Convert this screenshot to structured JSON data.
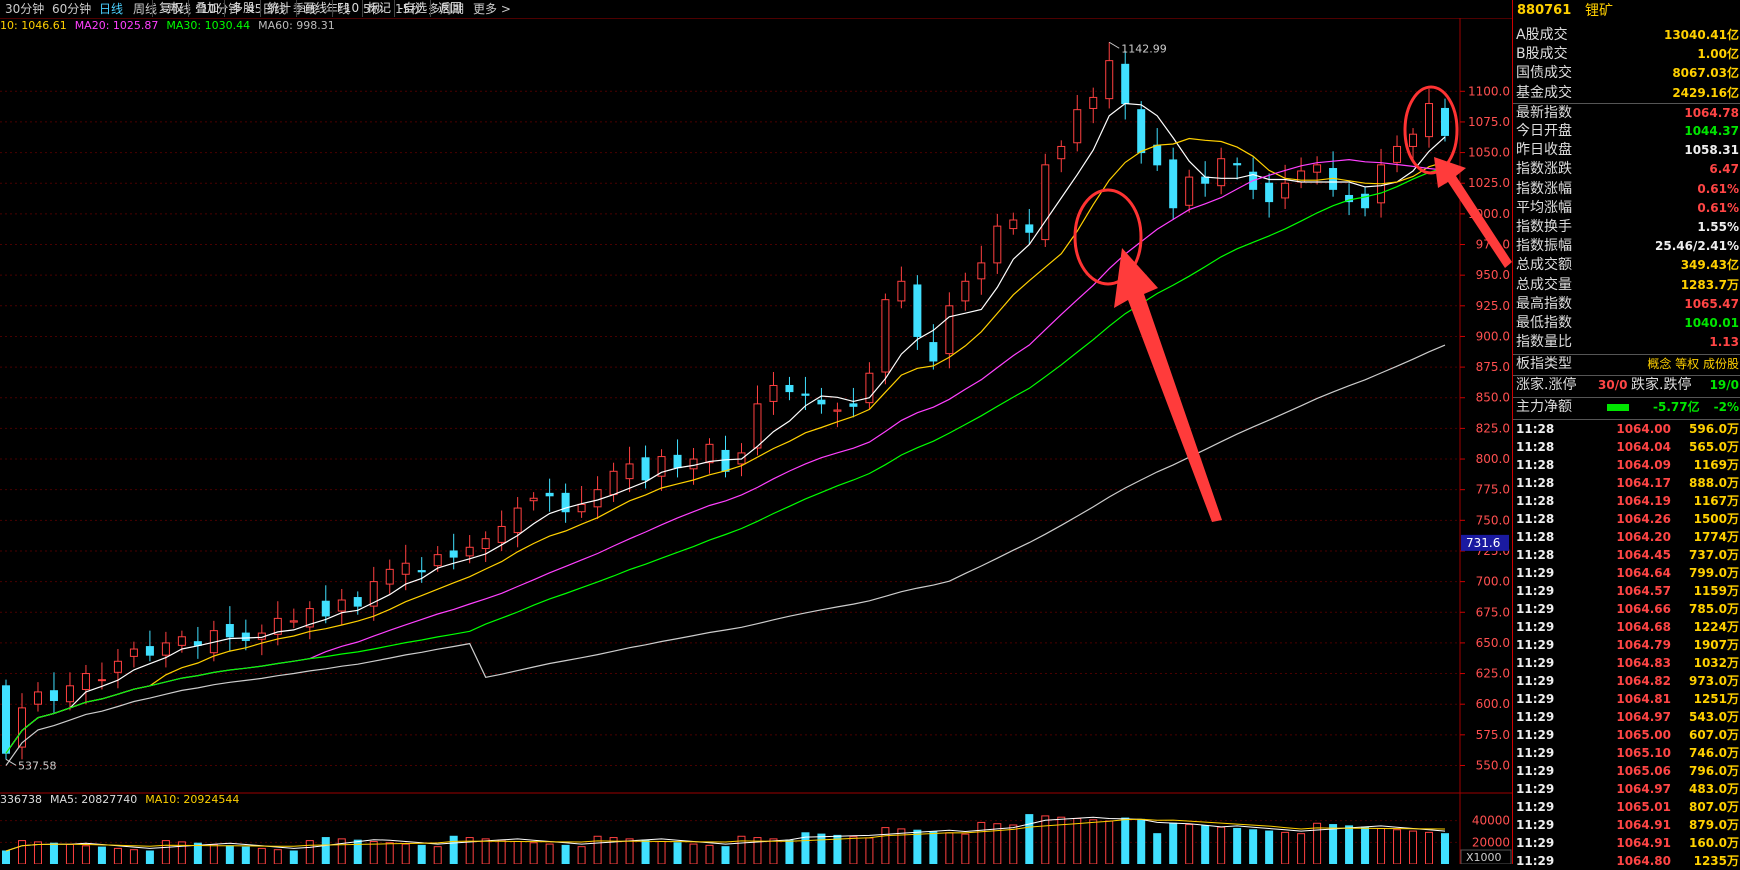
{
  "toolbar": {
    "periods": [
      "30分钟",
      "60分钟",
      "日线",
      "周线",
      "月线",
      "10分钟",
      "45日线",
      "季线",
      "年线",
      "5秒",
      "15秒",
      "多周期",
      "更多 >"
    ],
    "active_period": "日线",
    "tools": [
      "复权",
      "叠加",
      "多股",
      "统计",
      "画线",
      "F10",
      "标记",
      "-自选",
      "返回"
    ]
  },
  "ma_legend": [
    {
      "label": "10: 1046.61",
      "color": "#ffd000"
    },
    {
      "label": "MA20: 1025.87",
      "color": "#ff40ff"
    },
    {
      "label": "MA30: 1030.44",
      "color": "#00ff00"
    },
    {
      "label": "MA60: 998.31",
      "color": "#bbbbbb"
    }
  ],
  "vol_legend": [
    {
      "label": "336738",
      "color": "#dddddd"
    },
    {
      "label": "MA5: 20827740",
      "color": "#dddddd"
    },
    {
      "label": "MA10: 20924544",
      "color": "#ffd000"
    }
  ],
  "price_axis": {
    "ticks": [
      1100,
      1075,
      1050,
      1025,
      1000,
      975,
      950,
      925,
      900,
      875,
      850,
      825,
      800,
      775,
      750,
      725,
      700,
      675,
      650,
      625,
      600,
      575,
      550
    ]
  },
  "volume_axis": {
    "ticks": [
      "40000",
      "20000"
    ],
    "unit": "X1000"
  },
  "markers": {
    "high": "1142.99",
    "low": "537.58",
    "crosshair_price": "731.6"
  },
  "colors": {
    "up": "#ff4040",
    "down": "#40e0ff",
    "ma10": "#ffd000",
    "ma20": "#ff40ff",
    "ma30": "#00ff00",
    "ma60": "#cccccc",
    "annotation": "#ff3333"
  },
  "chart_data": {
    "type": "candlestick",
    "ylim": [
      530,
      1150
    ],
    "close": [
      560,
      597,
      610,
      603,
      615,
      625,
      620,
      635,
      645,
      640,
      650,
      655,
      648,
      660,
      655,
      652,
      658,
      670,
      668,
      678,
      672,
      685,
      680,
      700,
      710,
      715,
      708,
      722,
      720,
      728,
      735,
      745,
      760,
      768,
      770,
      757,
      763,
      775,
      790,
      796,
      783,
      802,
      793,
      800,
      812,
      790,
      805,
      845,
      860,
      855,
      852,
      845,
      840,
      843,
      870,
      930,
      945,
      900,
      880,
      925,
      945,
      960,
      990,
      995,
      985,
      1040,
      1055,
      1085,
      1095,
      1125,
      1090,
      1050,
      1040,
      1005,
      1030,
      1025,
      1045,
      1040,
      1020,
      1010,
      1025,
      1035,
      1040,
      1020,
      1010,
      1005,
      1040,
      1055,
      1065,
      1090,
      1064
    ]
  },
  "side": {
    "code": "880761",
    "name": "锂矿",
    "stats": [
      {
        "label": "A股成交",
        "value": "13040.41亿",
        "color": "yellow"
      },
      {
        "label": "B股成交",
        "value": "1.00亿",
        "color": "yellow"
      },
      {
        "label": "国债成交",
        "value": "8067.03亿",
        "color": "yellow"
      },
      {
        "label": "基金成交",
        "value": "2429.16亿",
        "color": "yellow"
      },
      {
        "label": "最新指数",
        "value": "1064.78",
        "color": "red"
      },
      {
        "label": "今日开盘",
        "value": "1044.37",
        "color": "green"
      },
      {
        "label": "昨日收盘",
        "value": "1058.31",
        "color": "white"
      },
      {
        "label": "指数涨跌",
        "value": "6.47",
        "color": "red"
      },
      {
        "label": "指数涨幅",
        "value": "0.61%",
        "color": "red"
      },
      {
        "label": "平均涨幅",
        "value": "0.61%",
        "color": "red"
      },
      {
        "label": "指数换手",
        "value": "1.55%",
        "color": "white"
      },
      {
        "label": "指数振幅",
        "value": "25.46/2.41%",
        "color": "white"
      },
      {
        "label": "总成交额",
        "value": "349.43亿",
        "color": "yellow"
      },
      {
        "label": "总成交量",
        "value": "1283.7万",
        "color": "yellow"
      },
      {
        "label": "最高指数",
        "value": "1065.47",
        "color": "red"
      },
      {
        "label": "最低指数",
        "value": "1040.01",
        "color": "green"
      },
      {
        "label": "指数量比",
        "value": "1.13",
        "color": "red"
      }
    ],
    "type_row": {
      "label": "板指类型",
      "opts": "概念 等权 成份股"
    },
    "updown_row": {
      "l1": "涨家.涨停",
      "v1": "30/0",
      "l2": "跌家.跌停",
      "v2": "19/0"
    },
    "flow_row": {
      "label": "主力净额",
      "value": "-5.77亿",
      "pct": "-2%"
    },
    "ticks": [
      {
        "t": "11:28",
        "p": "1064.00",
        "v": "596.0万"
      },
      {
        "t": "11:28",
        "p": "1064.04",
        "v": "565.0万"
      },
      {
        "t": "11:28",
        "p": "1064.09",
        "v": "1169万"
      },
      {
        "t": "11:28",
        "p": "1064.17",
        "v": "888.0万"
      },
      {
        "t": "11:28",
        "p": "1064.19",
        "v": "1167万"
      },
      {
        "t": "11:28",
        "p": "1064.26",
        "v": "1500万"
      },
      {
        "t": "11:28",
        "p": "1064.20",
        "v": "1774万"
      },
      {
        "t": "11:28",
        "p": "1064.45",
        "v": "737.0万"
      },
      {
        "t": "11:29",
        "p": "1064.64",
        "v": "799.0万"
      },
      {
        "t": "11:29",
        "p": "1064.57",
        "v": "1159万"
      },
      {
        "t": "11:29",
        "p": "1064.66",
        "v": "785.0万"
      },
      {
        "t": "11:29",
        "p": "1064.68",
        "v": "1224万"
      },
      {
        "t": "11:29",
        "p": "1064.79",
        "v": "1907万"
      },
      {
        "t": "11:29",
        "p": "1064.83",
        "v": "1032万"
      },
      {
        "t": "11:29",
        "p": "1064.82",
        "v": "973.0万"
      },
      {
        "t": "11:29",
        "p": "1064.81",
        "v": "1251万"
      },
      {
        "t": "11:29",
        "p": "1064.97",
        "v": "543.0万"
      },
      {
        "t": "11:29",
        "p": "1065.00",
        "v": "607.0万"
      },
      {
        "t": "11:29",
        "p": "1065.10",
        "v": "746.0万"
      },
      {
        "t": "11:29",
        "p": "1065.06",
        "v": "796.0万"
      },
      {
        "t": "11:29",
        "p": "1064.97",
        "v": "483.0万"
      },
      {
        "t": "11:29",
        "p": "1065.01",
        "v": "807.0万"
      },
      {
        "t": "11:29",
        "p": "1064.91",
        "v": "879.0万"
      },
      {
        "t": "11:29",
        "p": "1064.91",
        "v": "160.0万"
      },
      {
        "t": "11:29",
        "p": "1064.80",
        "v": "1235万"
      }
    ]
  }
}
